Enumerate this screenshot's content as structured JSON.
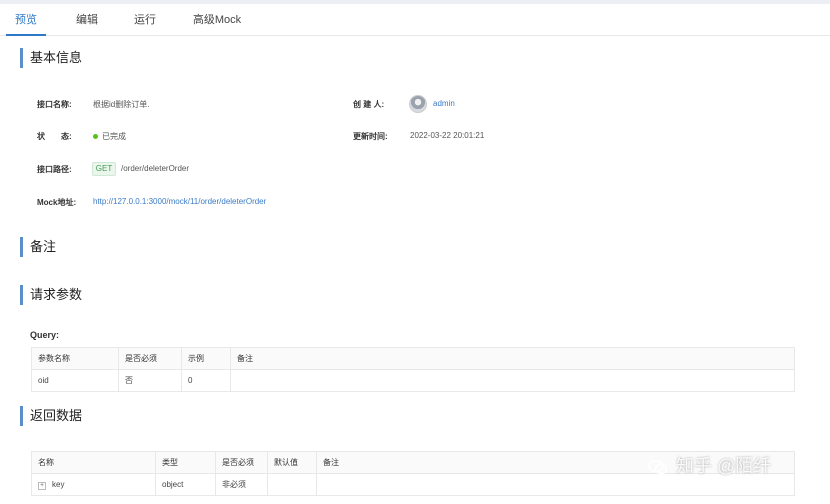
{
  "tabs": [
    {
      "label": "预览",
      "active": true
    },
    {
      "label": "编辑"
    },
    {
      "label": "运行"
    },
    {
      "label": "高级Mock"
    }
  ],
  "basic_info": {
    "title": "基本信息",
    "api_name_label": "接口名称:",
    "api_name": "根据id删除订单.",
    "creator_label": "创 建 人:",
    "creator": "admin",
    "status_label": "状　　态:",
    "status": "已完成",
    "update_time_label": "更新时间:",
    "update_time": "2022-03-22 20:01:21",
    "path_label": "接口路径:",
    "method": "GET",
    "path": "/order/deleterOrder",
    "mock_label": "Mock地址:",
    "mock_url": "http://127.0.0.1:3000/mock/11/order/deleterOrder"
  },
  "remarks": {
    "title": "备注"
  },
  "request": {
    "title": "请求参数",
    "query_label": "Query:",
    "headers": [
      "参数名称",
      "是否必须",
      "示例",
      "备注"
    ],
    "rows": [
      [
        "oid",
        "否",
        "0",
        ""
      ]
    ]
  },
  "response": {
    "title": "返回数据",
    "headers": [
      "名称",
      "类型",
      "是否必须",
      "默认值",
      "备注"
    ],
    "rows": [
      [
        "key",
        "object",
        "非必须",
        "",
        ""
      ]
    ]
  },
  "watermark": "知乎 @陌纤",
  "colors": {
    "accent": "#2f78c9",
    "status_done": "#52c41a",
    "link": "#3b7bc6"
  }
}
